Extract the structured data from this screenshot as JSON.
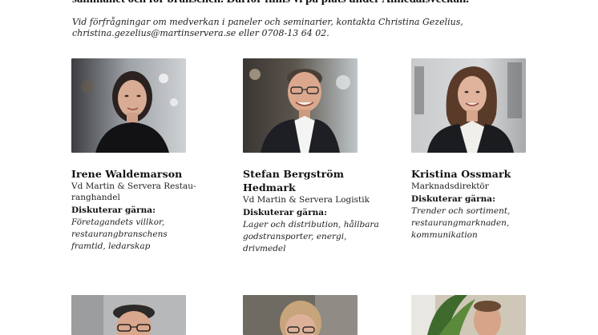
{
  "intro": {
    "top_line": "sammanet och för branschen. Därför finns vi på plats under Almedalsveckan.",
    "contact": "Vid förfrågningar om medverkan i paneler och seminarier, kontakta Christina Gezelius, christina.gezelius@martinservera.se eller 0708-13 64 02."
  },
  "people": [
    {
      "name": "Irene Waldemarson",
      "role": "Vd Martin & Servera Restau-ranghandel",
      "discuss_label": "Diskuterar gärna:",
      "topics": "Företagandets villkor, restaurangbranschens framtid, ledarskap"
    },
    {
      "name": "Stefan Bergström Hedmark",
      "role": "Vd Martin & Servera Logistik",
      "discuss_label": "Diskuterar gärna:",
      "topics": "Lager och distribution, hållbara godstransporter, energi, drivmedel"
    },
    {
      "name": "Kristina Ossmark",
      "role": "Marknadsdirektör",
      "discuss_label": "Diskuterar gärna:",
      "topics": "Trender och sortiment, restaurangmarknaden, kommunikation"
    }
  ],
  "colors": {
    "text": "#1a1a1a",
    "photo_bg_gray": "#c9ccce",
    "photo_bg_dark": "#3d3a36",
    "blazer": "#1f1f24",
    "skin": "#d8ab93"
  }
}
